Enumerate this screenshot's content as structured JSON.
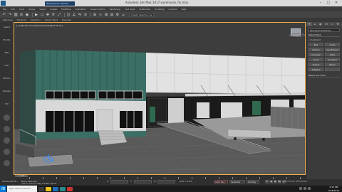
{
  "title_bar": {
    "workspace": "Workspaces: Default",
    "window_title": "Autodesk 3ds Max 2017   warehouse_fin.max",
    "minimize": "–",
    "maximize": "□",
    "close": "✕"
  },
  "menu": [
    "File",
    "Edit",
    "Tools",
    "Group",
    "Views",
    "Create",
    "Modifiers",
    "Animation",
    "Graph Editors",
    "Rendering",
    "Civil View",
    "Customize",
    "Scripting",
    "Content",
    "Help"
  ],
  "toolbar": {
    "icons": [
      "undo-icon",
      "redo-icon",
      "link-icon",
      "unlink-icon",
      "bind-icon",
      "select-icon",
      "region-icon",
      "move-icon",
      "rotate-icon",
      "scale-icon",
      "snap-icon",
      "angle-snap-icon",
      "mirror-icon",
      "align-icon",
      "layer-icon",
      "curve-icon",
      "schematic-icon",
      "material-icon",
      "render-setup-icon",
      "render-icon"
    ],
    "glyphs": [
      "↶",
      "↷",
      "⛓",
      "⊘",
      "◉",
      "▶",
      "▭",
      "✥",
      "⟳",
      "⤢",
      "◫",
      "∠",
      "⇋",
      "≡",
      "☰",
      "∿",
      "⊞",
      "◍",
      "⚙",
      "☕"
    ],
    "selection_set": "Create Selection Se"
  },
  "ribbon": [
    "Modeling",
    "Freeform",
    "Selection",
    "Object Paint",
    "Populate"
  ],
  "left_tools": [
    "Select",
    "Modify",
    "Edit",
    "Hier",
    "Motion",
    "Display",
    "Util"
  ],
  "viewport": {
    "label": "[+] [Perspective] [Standard] [Edged Faces]"
  },
  "command_panel": {
    "tabs": [
      "+",
      "⌂",
      "◐",
      "⊡",
      "▭",
      "⚒"
    ],
    "dropdown": "Standard Primitives",
    "section_object_type": "Object Type",
    "autogrid": "AutoGrid",
    "object_buttons": [
      "Box",
      "Cone",
      "Sphere",
      "GeoSphere",
      "Cylinder",
      "Tube",
      "Torus",
      "Pyramid",
      "Teapot",
      "Plane",
      "TextPlus",
      ""
    ],
    "section_name_color": "Name and Color"
  },
  "timeline": {
    "frame": "0 / 100"
  },
  "status": {
    "maxscript": "MAXScript Mi...",
    "selected": "None Selected",
    "hint": "Click or click-and-drag to select objects",
    "x_label": "X:",
    "y_label": "Y:",
    "z_label": "Z:",
    "grid": "Grid = 10.0",
    "auto_key": "Auto Key",
    "set_key": "Set Key",
    "selected_btn": "Selected",
    "playback": [
      "⏮",
      "◀",
      "▶",
      "▶|",
      "⏭"
    ]
  },
  "watermark": "Activate Windows",
  "taskbar": {
    "search_placeholder": "Type here to search",
    "time": "4:32 PM",
    "date": "9/18/2019"
  },
  "colors": {
    "viewport_border": "#f2b04a",
    "facade_green": "#3b6f66",
    "taskbar": "#1b1b1b",
    "start": "#0078d7"
  }
}
